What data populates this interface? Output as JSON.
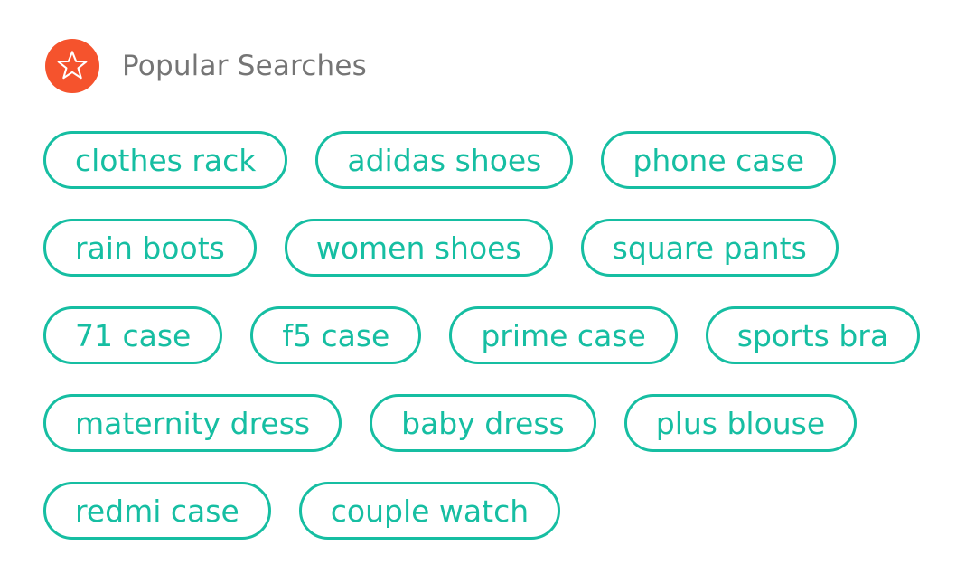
{
  "header": {
    "icon": "star-icon",
    "title": "Popular Searches",
    "accent_color": "#f5532d"
  },
  "chip_color": "#16bea2",
  "rows": [
    [
      "clothes rack",
      "adidas shoes",
      "phone case"
    ],
    [
      "rain boots",
      "women shoes",
      "square pants"
    ],
    [
      "71 case",
      "f5 case",
      "prime case",
      "sports bra"
    ],
    [
      "maternity dress",
      "baby dress",
      "plus blouse"
    ],
    [
      "redmi case",
      "couple watch"
    ]
  ]
}
